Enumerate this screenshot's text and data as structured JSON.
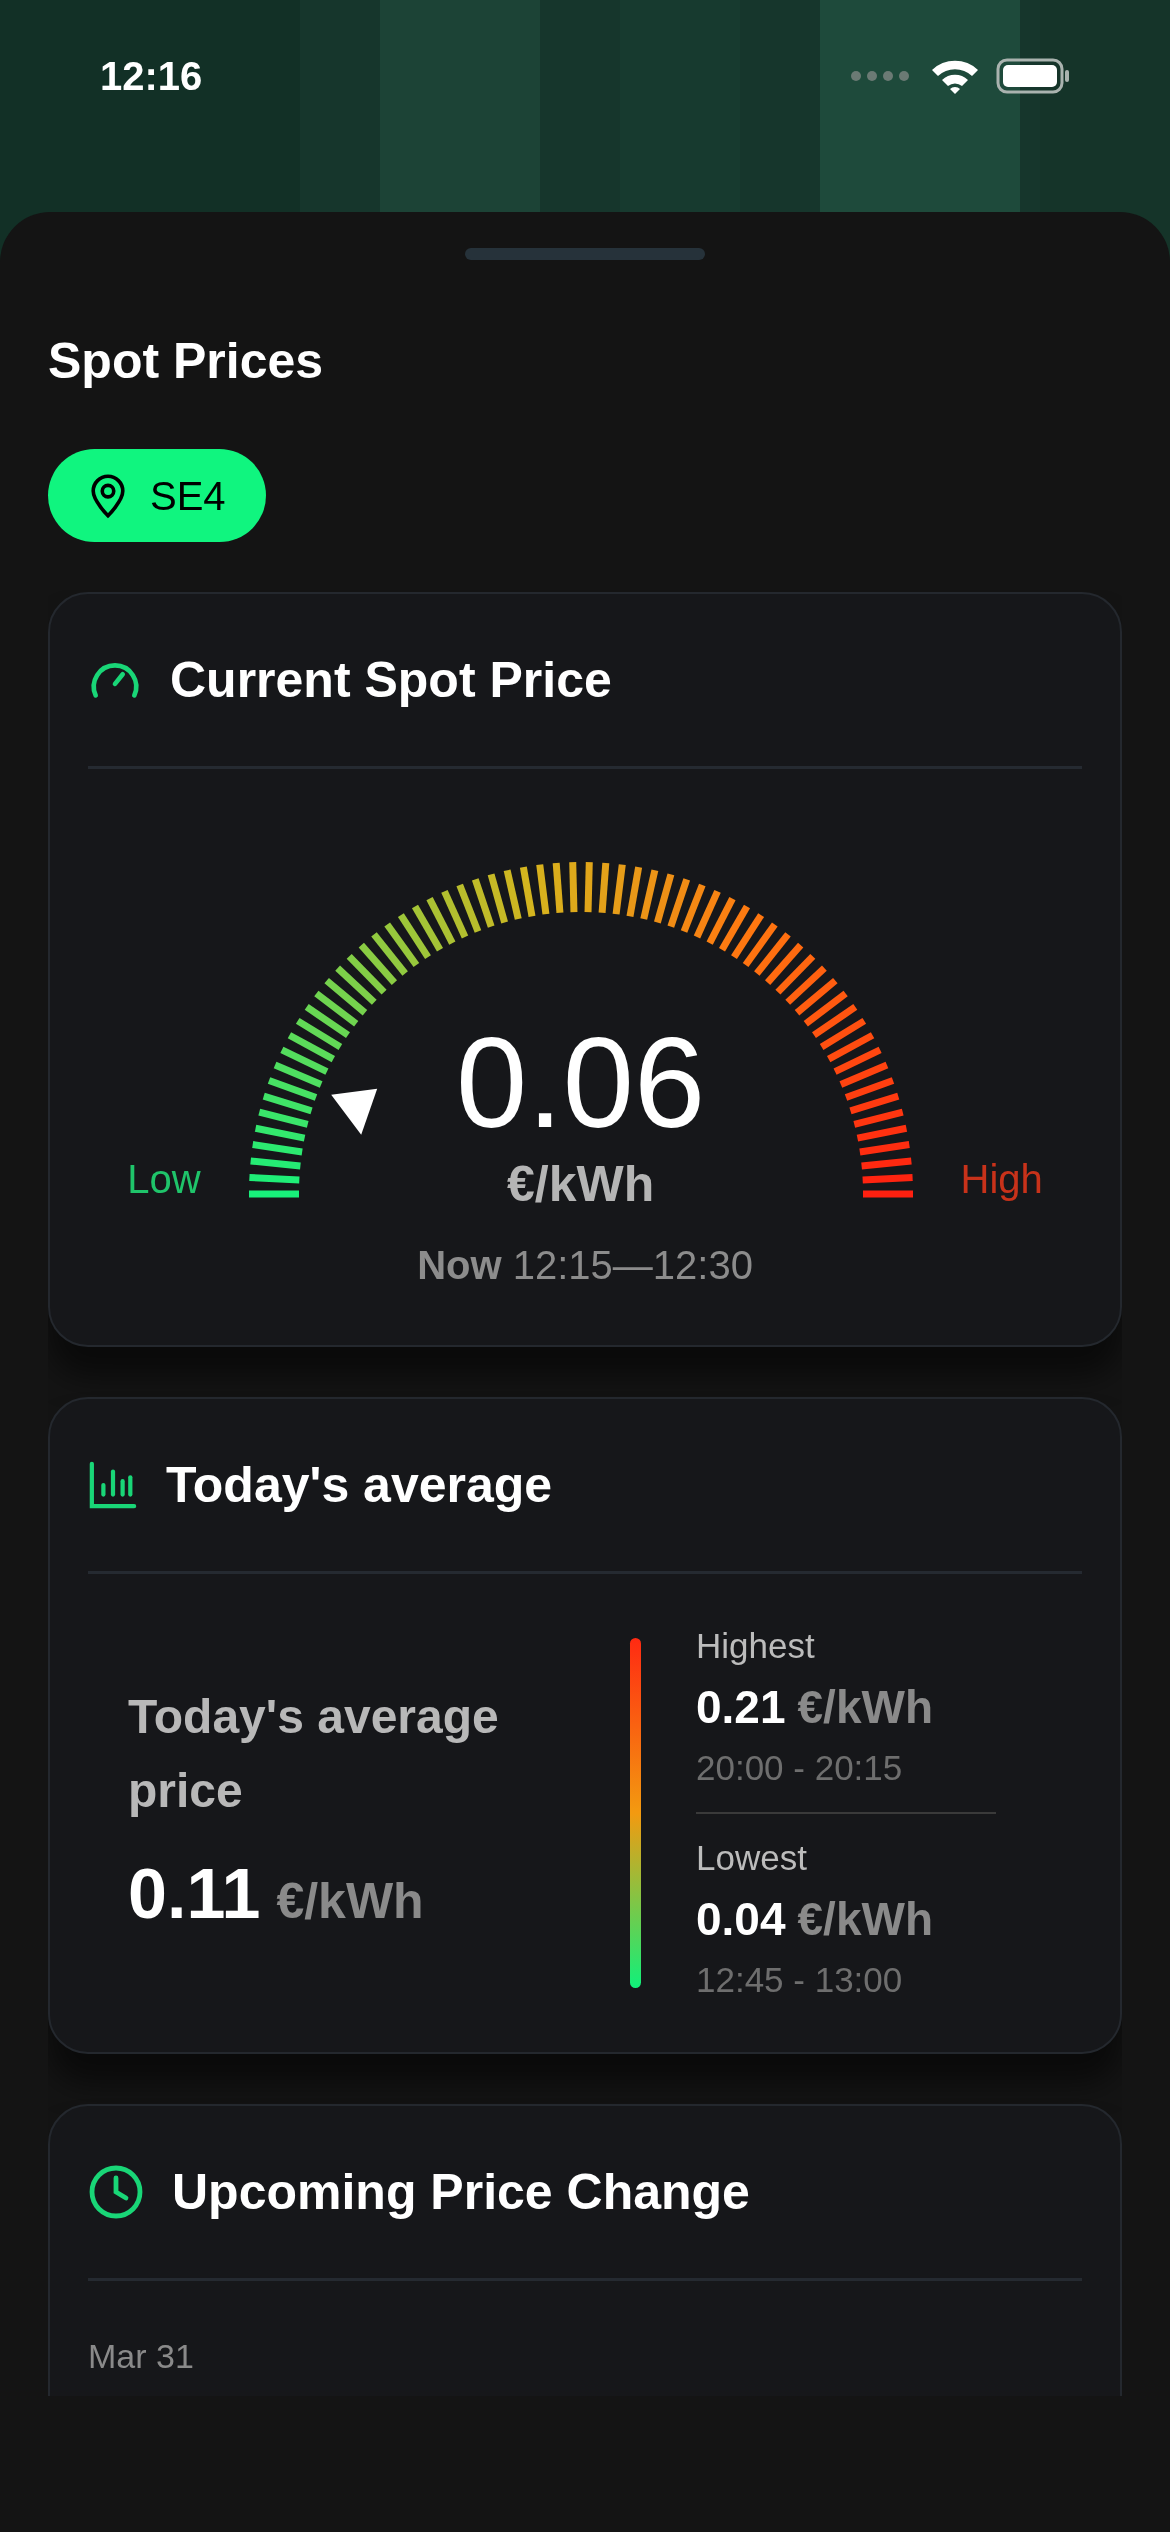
{
  "status_bar": {
    "time": "12:16"
  },
  "sheet": {
    "title": "Spot Prices",
    "region": "SE4"
  },
  "current": {
    "title": "Current Spot Price",
    "low_label": "Low",
    "high_label": "High",
    "value": "0.06",
    "unit": "€/kWh",
    "period": "**Now** 12:15—12:30",
    "gauge": {
      "level": 0.11
    }
  },
  "average": {
    "title": "Today's average",
    "label": "Today's average price",
    "value": "0.11",
    "unit": "€/kWh",
    "extremes": [
      {
        "label": "Highest",
        "value": "0.21",
        "unit": "€/kWh",
        "time": "20:00 - 20:15"
      },
      {
        "label": "Lowest",
        "value": "0.04",
        "unit": "€/kWh",
        "time": "12:45 - 13:00"
      }
    ]
  },
  "upcoming": {
    "title": "Upcoming Price Change",
    "date": "Mar 31"
  }
}
